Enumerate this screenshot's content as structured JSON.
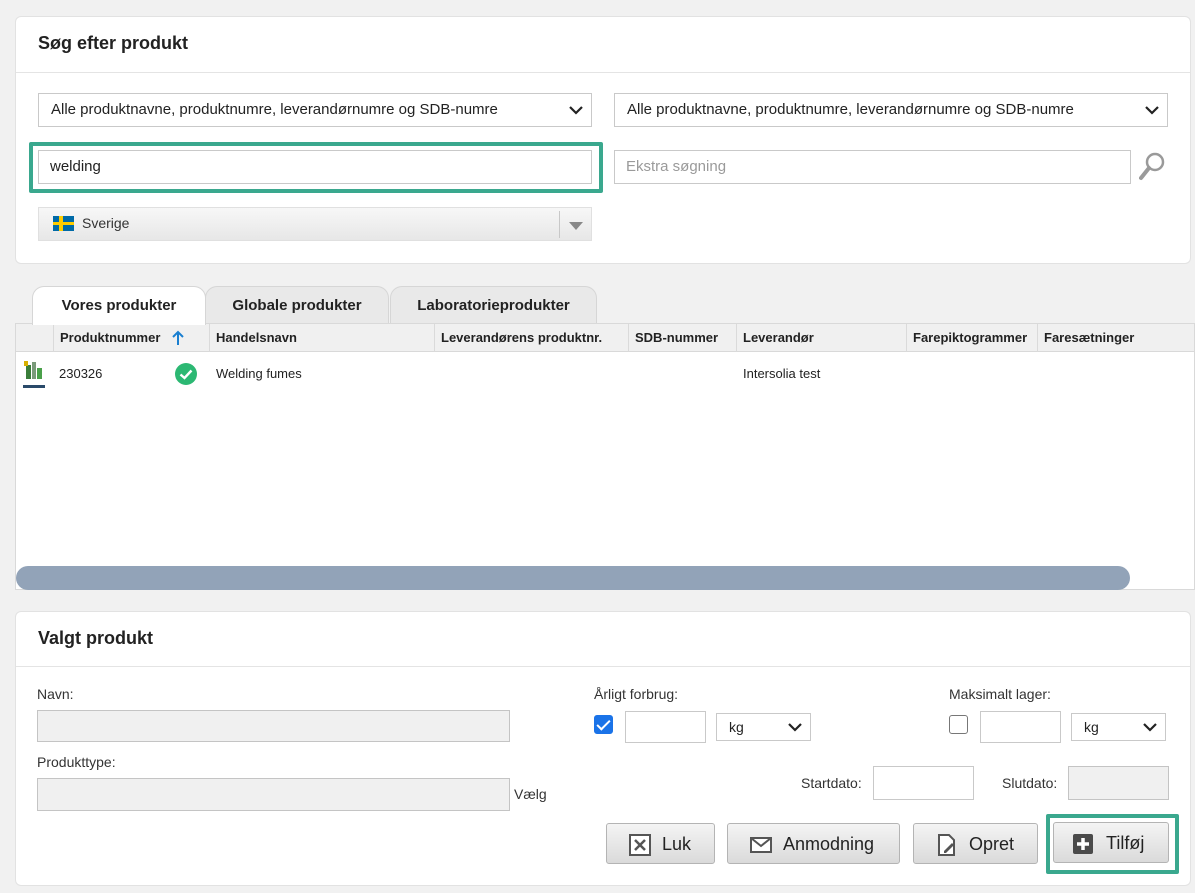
{
  "search_panel": {
    "title": "Søg efter produkt",
    "filter1": "Alle produktnavne, produktnumre, leverandørnumre og SDB-numre",
    "filter2": "Alle produktnavne, produktnumre, leverandørnumre og SDB-numre",
    "search_value": "welding",
    "extra_search_placeholder": "Ekstra søgning",
    "country": "Sverige"
  },
  "tabs": [
    "Vores produkter",
    "Globale produkter",
    "Laboratorieprodukter"
  ],
  "grid": {
    "columns": [
      "Produktnummer",
      "Handelsnavn",
      "Leverandørens produktnr.",
      "SDB-nummer",
      "Leverandør",
      "Farepiktogrammer",
      "Faresætninger"
    ],
    "rows": [
      {
        "product_number": "230326",
        "trade_name": "Welding fumes",
        "supplier_product_no": "",
        "sdb_number": "",
        "supplier": "Intersolia test"
      }
    ]
  },
  "selected_panel": {
    "title": "Valgt produkt",
    "name_label": "Navn:",
    "product_type_label": "Produkttype:",
    "choose_link": "Vælg",
    "annual_usage_label": "Årligt forbrug:",
    "annual_unit": "kg",
    "max_stock_label": "Maksimalt lager:",
    "max_unit": "kg",
    "start_date_label": "Startdato:",
    "end_date_label": "Slutdato:"
  },
  "buttons": {
    "close": "Luk",
    "request": "Anmodning",
    "create": "Opret",
    "add": "Tilføj"
  },
  "colors": {
    "highlight": "#3aa88e",
    "scrollbar": "#92a3b8",
    "check": "#1a73e8",
    "status_ok": "#2cb873"
  }
}
